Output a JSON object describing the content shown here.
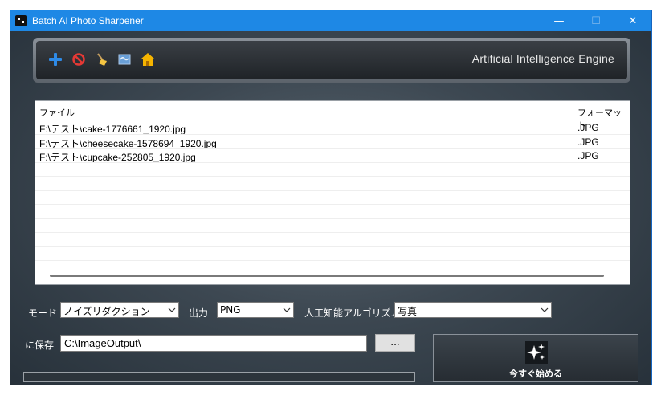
{
  "window": {
    "title": "Batch AI Photo Sharpener",
    "controls": {
      "minimize": "—",
      "maximize": "☐",
      "close": "✕"
    }
  },
  "toolbar": {
    "icons": [
      "add-icon",
      "remove-icon",
      "clear-icon",
      "open-folder-icon",
      "home-icon"
    ],
    "engine_label": "Artificial Intelligence Engine"
  },
  "file_table": {
    "headers": {
      "file": "ファイル",
      "format": "フォーマット"
    },
    "rows": [
      {
        "file": "F:\\テスト\\cake-1776661_1920.jpg",
        "format": ".JPG"
      },
      {
        "file": "F:\\テスト\\cheesecake-1578694_1920.jpg",
        "format": ".JPG"
      },
      {
        "file": "F:\\テスト\\cupcake-252805_1920.jpg",
        "format": ".JPG"
      },
      {
        "file": "",
        "format": ""
      },
      {
        "file": "",
        "format": ""
      },
      {
        "file": "",
        "format": ""
      },
      {
        "file": "",
        "format": ""
      },
      {
        "file": "",
        "format": ""
      },
      {
        "file": "",
        "format": ""
      },
      {
        "file": "",
        "format": ""
      },
      {
        "file": "",
        "format": ""
      }
    ]
  },
  "options": {
    "mode_label": "モード",
    "mode_value": "ノイズリダクション",
    "output_label": "出力",
    "output_value": "PNG",
    "algorithm_label": "人工知能アルゴリズム",
    "algorithm_value": "写真"
  },
  "save": {
    "label": "に保存",
    "path": "C:\\ImageOutput\\",
    "browse_label": "..."
  },
  "start_button": {
    "label": "今すぐ始める"
  },
  "progress": {
    "value": 0
  },
  "colors": {
    "titlebar": "#1e88e5",
    "accent_add": "#2e8ae6",
    "accent_remove": "#e53935",
    "accent_home": "#f5b400"
  }
}
